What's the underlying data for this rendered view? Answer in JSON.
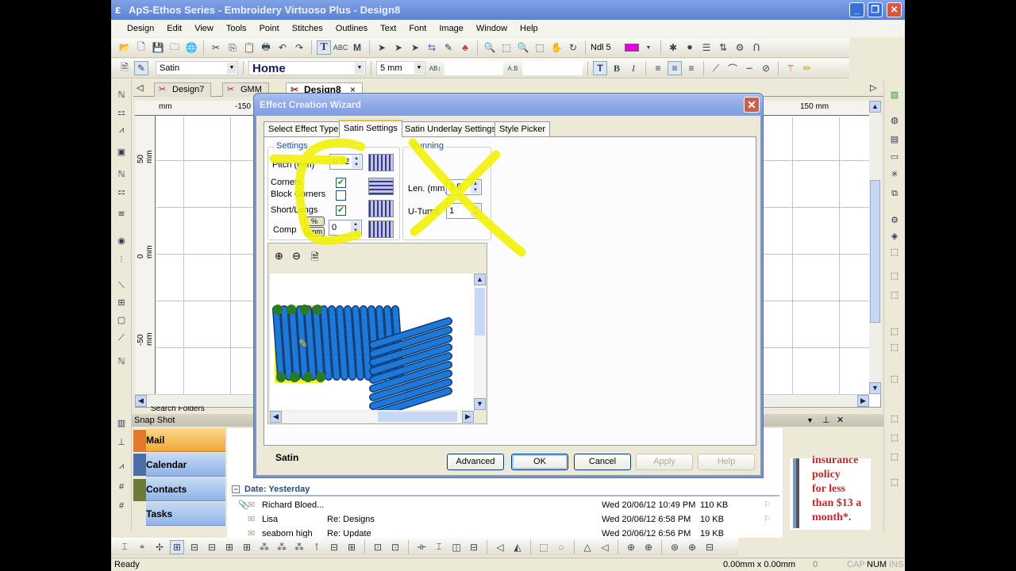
{
  "window": {
    "title": "ApS-Ethos Series - Embroidery Virtuoso Plus - Design8"
  },
  "menu": [
    "Design",
    "Edit",
    "View",
    "Tools",
    "Point",
    "Stitches",
    "Outlines",
    "Text",
    "Font",
    "Image",
    "Window",
    "Help"
  ],
  "toolbar": {
    "needle": "Ndl 5",
    "needle_color": "#e600e6",
    "stitch_type": "Satin",
    "font_name": "Home",
    "font_size": "5 mm"
  },
  "doc_tabs": [
    {
      "label": "Design7",
      "active": false
    },
    {
      "label": "GMM",
      "active": false
    },
    {
      "label": "Design8",
      "active": true,
      "close": "×"
    }
  ],
  "rulers": {
    "top_unit": "mm",
    "top_left": "-150",
    "top_right": "150 mm",
    "left": [
      "50 mm",
      "0 mm",
      "-50 mm"
    ]
  },
  "snapshot": {
    "title": "Snap Shot",
    "search_folders": "Search Folders",
    "nav": [
      {
        "label": "Mail",
        "active": true
      },
      {
        "label": "Calendar",
        "active": false
      },
      {
        "label": "Contacts",
        "active": false
      },
      {
        "label": "Tasks",
        "active": false
      }
    ],
    "group_header": "Date: Yesterday",
    "emails": [
      {
        "from": "Richard Bloed...",
        "subject": "",
        "date": "Wed 20/06/12 10:49 PM",
        "size": "110 KB",
        "attachment": true
      },
      {
        "from": "Lisa",
        "subject": "Re: Designs",
        "date": "Wed 20/06/12 6:58 PM",
        "size": "10 KB",
        "attachment": false
      },
      {
        "from": "seaborn high",
        "subject": "Re: Update",
        "date": "Wed 20/06/12 6:56 PM",
        "size": "19 KB",
        "attachment": false
      }
    ],
    "ad_lines": [
      "insurance",
      "policy",
      "for less",
      "than $13 a",
      "month*."
    ]
  },
  "status": {
    "left": "Ready",
    "dims": "0.00mm x 0.00mm",
    "zero": "0",
    "cap": "CAP",
    "num": "NUM",
    "ins": "INS"
  },
  "dialog": {
    "title": "Effect Creation Wizard",
    "tabs": [
      {
        "label": "Select Effect Type",
        "active": false
      },
      {
        "label": "Satin Settings",
        "active": true
      },
      {
        "label": "Satin Underlay Settings",
        "active": false
      },
      {
        "label": "Style Picker",
        "active": false
      }
    ],
    "settings": {
      "group": "Settings",
      "pitch_label": "Pitch (mm)",
      "pitch": "0.52",
      "corners_label": "Corners",
      "corners": true,
      "block_corners_label": "Block Corners",
      "block_corners": false,
      "short_longs_label": "Short/Longs",
      "short_longs": true,
      "comp_label": "Comp",
      "comp_pct": "%",
      "comp_mm": "1mm",
      "comp": "0"
    },
    "running": {
      "group": "Running",
      "len_label": "Len. (mm)",
      "len": "2.5",
      "uturns_label": "U-Turns",
      "uturns": "1"
    },
    "effect_name": "Satin",
    "buttons": {
      "advanced": "Advanced",
      "ok": "OK",
      "cancel": "Cancel",
      "apply": "Apply",
      "help": "Help"
    }
  },
  "colors": {
    "annotation": "#f2f20a",
    "stitch": "#1e78d8",
    "outlook_active": "#f1a73a"
  }
}
